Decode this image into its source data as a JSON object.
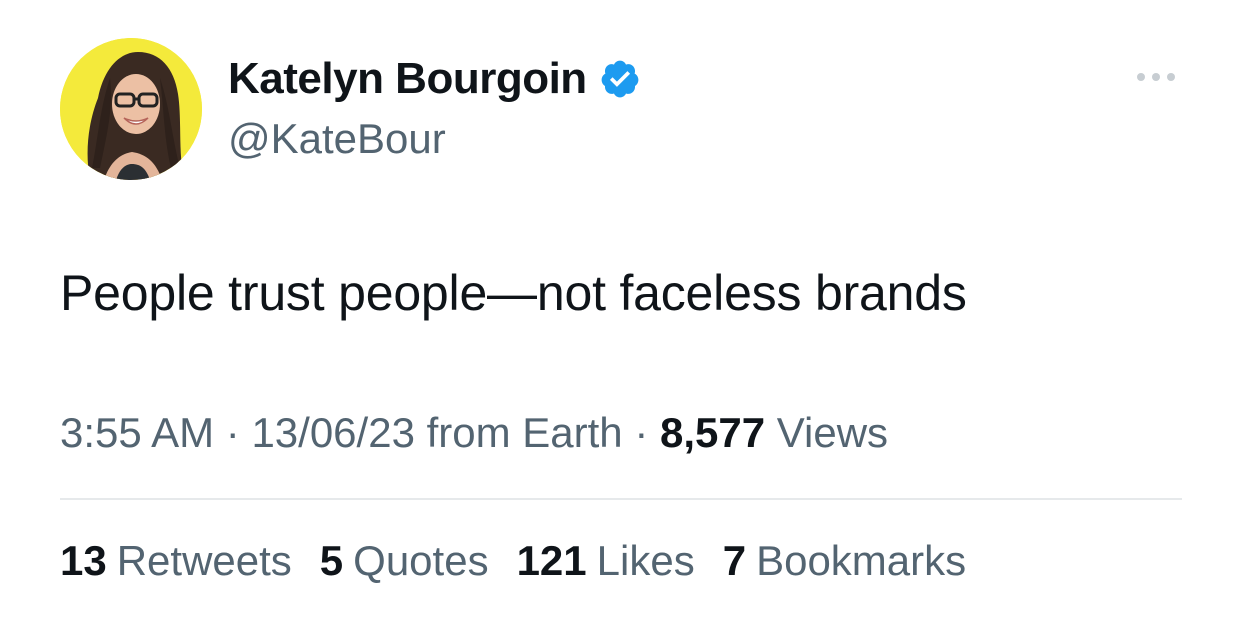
{
  "author": {
    "display_name": "Katelyn Bourgoin",
    "handle": "@KateBour",
    "verified": true,
    "avatar_bg": "#f4ea3b",
    "verified_color": "#1d9bf0"
  },
  "more_menu": {
    "icon": "more-horizontal-icon"
  },
  "tweet": {
    "text": "People trust people—not faceless brands"
  },
  "meta": {
    "time": "3:55 AM",
    "sep1": " · ",
    "date": "13/06/23",
    "source": " from Earth",
    "sep2": " · ",
    "views_count": "8,577",
    "views_label": " Views"
  },
  "stats": {
    "retweets": {
      "count": "13",
      "label": "Retweets"
    },
    "quotes": {
      "count": "5",
      "label": "Quotes"
    },
    "likes": {
      "count": "121",
      "label": "Likes"
    },
    "bookmarks": {
      "count": "7",
      "label": "Bookmarks"
    }
  }
}
